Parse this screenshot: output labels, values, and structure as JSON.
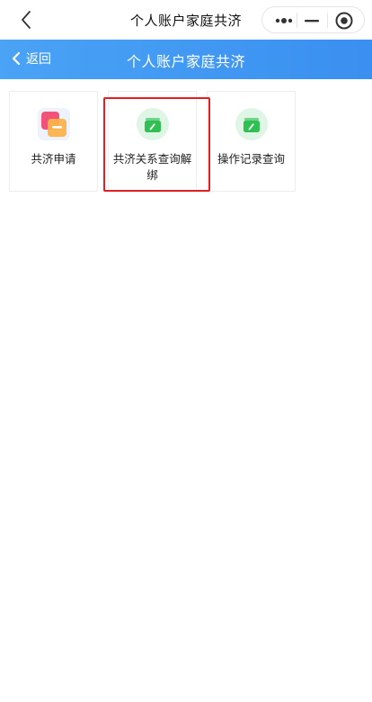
{
  "topbar": {
    "title": "个人账户家庭共济",
    "back_icon": "chevron-left-icon",
    "capsule_icons": [
      "more-icon",
      "minimize-icon",
      "close-circle-icon"
    ]
  },
  "header": {
    "back_label": "返回",
    "title": "个人账户家庭共济",
    "gradient": [
      "#4aa3f5",
      "#3a8ff0"
    ]
  },
  "grid": {
    "items": [
      {
        "label": "共济申请",
        "icon": "apply-card-icon"
      },
      {
        "label": "共济关系查询解绑",
        "icon": "wallet-green-icon"
      },
      {
        "label": "操作记录查询",
        "icon": "wallet-green-icon"
      }
    ]
  },
  "colors": {
    "accent": "#3a8ff0",
    "highlight": "#e02020",
    "green": "#2fbf52"
  }
}
